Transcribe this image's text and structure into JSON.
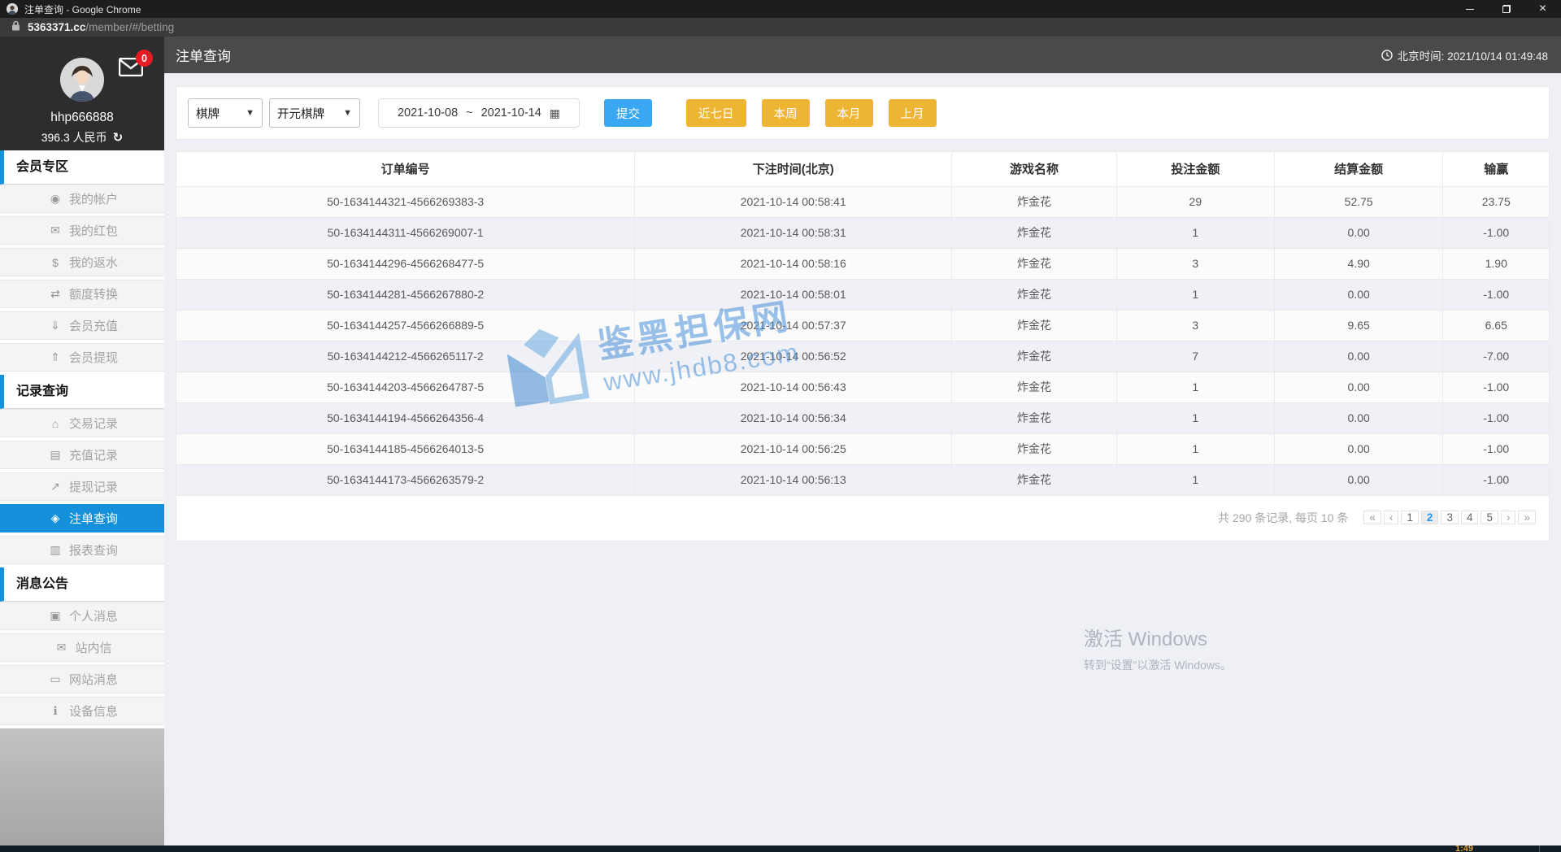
{
  "colors": {
    "accent_blue": "#1591dc",
    "submit_blue": "#3aa7f3",
    "quick_yellow": "#eeb434",
    "badge_red": "#e51c23",
    "header_gray": "#4a4a4a",
    "watermark_blue": "#4a90d9"
  },
  "titlebar": {
    "title": "注单查询 - Google Chrome"
  },
  "urlbar": {
    "domain": "5363371.cc",
    "path": "/member/#/betting"
  },
  "profile": {
    "username": "hhp666888",
    "balance": "396.3 人民币",
    "refresh_glyph": "↻",
    "message_badge": "0"
  },
  "sidebar": {
    "sections": [
      {
        "title": "会员专区",
        "items": [
          {
            "id": "account",
            "icon": "user-icon",
            "glyph": "◉",
            "label": "我的帐户"
          },
          {
            "id": "red-packet",
            "icon": "red-packet-icon",
            "glyph": "✉",
            "label": "我的红包"
          },
          {
            "id": "rebate",
            "icon": "dollar-icon",
            "glyph": "$",
            "label": "我的返水"
          },
          {
            "id": "quota-transfer",
            "icon": "transfer-arrows-icon",
            "glyph": "⇄",
            "label": "额度转换"
          },
          {
            "id": "deposit",
            "icon": "download-icon",
            "glyph": "⇓",
            "label": "会员充值"
          },
          {
            "id": "withdraw",
            "icon": "upload-icon",
            "glyph": "⇑",
            "label": "会员提现"
          }
        ]
      },
      {
        "title": "记录查询",
        "items": [
          {
            "id": "transaction-records",
            "icon": "bank-icon",
            "glyph": "⌂",
            "label": "交易记录"
          },
          {
            "id": "deposit-records",
            "icon": "card-icon",
            "glyph": "▤",
            "label": "充值记录"
          },
          {
            "id": "withdraw-records",
            "icon": "chart-line-icon",
            "glyph": "↗",
            "label": "提现记录"
          },
          {
            "id": "bet-query",
            "icon": "ticket-icon",
            "glyph": "◈",
            "label": "注单查询",
            "active": true
          },
          {
            "id": "report-query",
            "icon": "report-icon",
            "glyph": "▥",
            "label": "报表查询"
          }
        ]
      },
      {
        "title": "消息公告",
        "items": [
          {
            "id": "personal-messages",
            "icon": "id-card-icon",
            "glyph": "▣",
            "label": "个人消息"
          },
          {
            "id": "inbox",
            "icon": "envelope-icon",
            "glyph": "✉",
            "label": "站内信"
          },
          {
            "id": "site-messages",
            "icon": "monitor-icon",
            "glyph": "▭",
            "label": "网站消息"
          },
          {
            "id": "device-info",
            "icon": "info-icon",
            "glyph": "ℹ",
            "label": "设备信息"
          }
        ]
      }
    ]
  },
  "main": {
    "title": "注单查询",
    "beijing_time": "北京时间: 2021/10/14 01:49:48"
  },
  "filters": {
    "game_type": "棋牌",
    "provider": "开元棋牌",
    "date_from": "2021-10-08",
    "date_separator": "~",
    "date_to": "2021-10-14",
    "calendar_glyph": "▦",
    "submit_label": "提交",
    "quick_buttons": [
      "近七日",
      "本周",
      "本月",
      "上月"
    ]
  },
  "table": {
    "columns": [
      "订单编号",
      "下注时间(北京)",
      "游戏名称",
      "投注金额",
      "结算金额",
      "输赢"
    ],
    "rows": [
      [
        "50-1634144321-4566269383-3",
        "2021-10-14 00:58:41",
        "炸金花",
        "29",
        "52.75",
        "23.75"
      ],
      [
        "50-1634144311-4566269007-1",
        "2021-10-14 00:58:31",
        "炸金花",
        "1",
        "0.00",
        "-1.00"
      ],
      [
        "50-1634144296-4566268477-5",
        "2021-10-14 00:58:16",
        "炸金花",
        "3",
        "4.90",
        "1.90"
      ],
      [
        "50-1634144281-4566267880-2",
        "2021-10-14 00:58:01",
        "炸金花",
        "1",
        "0.00",
        "-1.00"
      ],
      [
        "50-1634144257-4566266889-5",
        "2021-10-14 00:57:37",
        "炸金花",
        "3",
        "9.65",
        "6.65"
      ],
      [
        "50-1634144212-4566265117-2",
        "2021-10-14 00:56:52",
        "炸金花",
        "7",
        "0.00",
        "-7.00"
      ],
      [
        "50-1634144203-4566264787-5",
        "2021-10-14 00:56:43",
        "炸金花",
        "1",
        "0.00",
        "-1.00"
      ],
      [
        "50-1634144194-4566264356-4",
        "2021-10-14 00:56:34",
        "炸金花",
        "1",
        "0.00",
        "-1.00"
      ],
      [
        "50-1634144185-4566264013-5",
        "2021-10-14 00:56:25",
        "炸金花",
        "1",
        "0.00",
        "-1.00"
      ],
      [
        "50-1634144173-4566263579-2",
        "2021-10-14 00:56:13",
        "炸金花",
        "1",
        "0.00",
        "-1.00"
      ]
    ]
  },
  "pagination": {
    "summary": "共 290 条记录, 每页 10 条",
    "buttons": [
      "«",
      "‹",
      "1",
      "2",
      "3",
      "4",
      "5",
      "›",
      "»"
    ],
    "active": "2"
  },
  "watermark": {
    "line1": "鉴黑担保网",
    "line2": "www.jhdb8.com"
  },
  "activate_watermark": {
    "line1": "激活 Windows",
    "line2": "转到“设置”以激活 Windows。"
  },
  "taskbar_fragment": "1:49"
}
